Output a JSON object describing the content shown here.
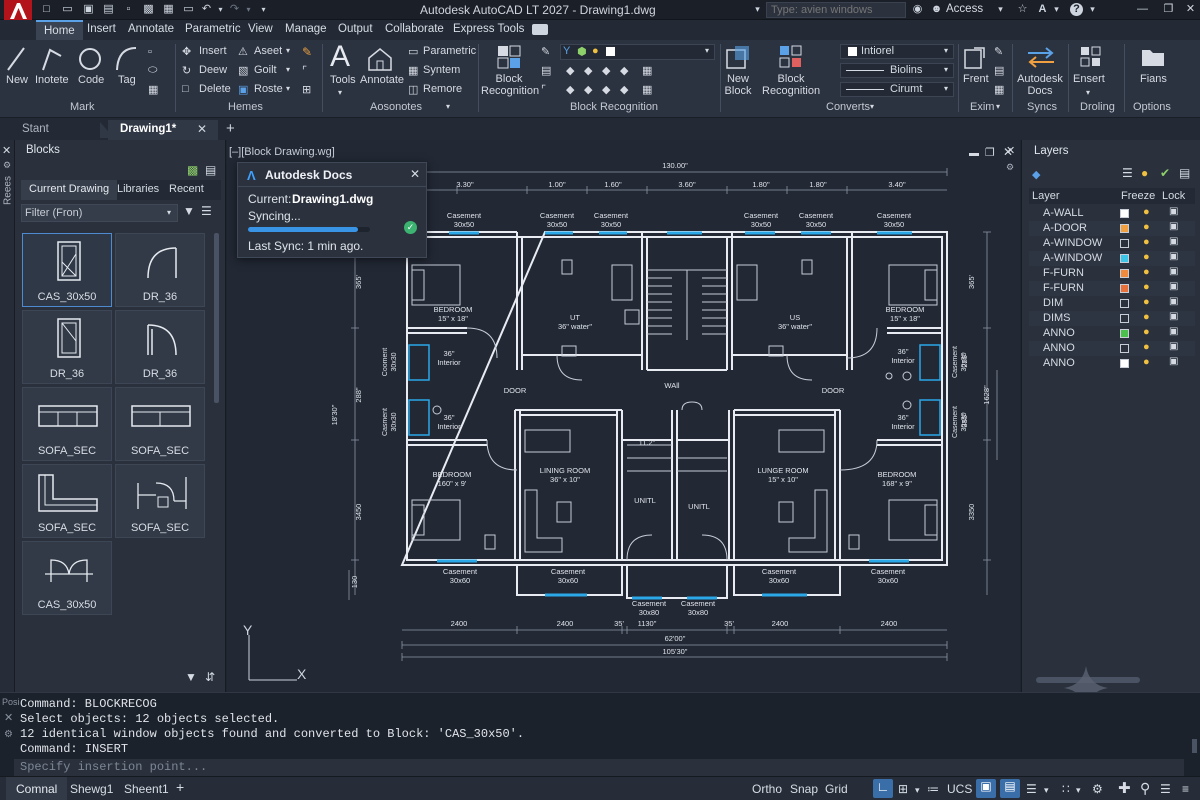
{
  "app": {
    "title": "Autodesk AutoCAD LT 2027 - Drawing1.dwg",
    "search_placeholder": "Type: avien windows",
    "access": "Access"
  },
  "menus": [
    "Home",
    "Insert",
    "Annotate",
    "Parametric",
    "View",
    "Manage",
    "Output",
    "Collaborate",
    "Express Tools"
  ],
  "ribbon": {
    "mark": {
      "new": "New",
      "inotete": "Inotete",
      "code": "Code",
      "tag": "Tag",
      "label": "Mark"
    },
    "hemes": {
      "insert": "Insert",
      "deew": "Deew",
      "delete": "Delete",
      "aseet": "Aseet",
      "goilt": "Goilt",
      "roste": "Roste",
      "label": "Hemes"
    },
    "aosonotes": {
      "tools": "Tools",
      "annotate": "Annotate",
      "parametric": "Parametric",
      "syntem": "Syntem",
      "remore": "Remore",
      "label": "Aosonotes"
    },
    "block_recognition": {
      "btn": "Block\nRecognition",
      "label": "Block Recognition"
    },
    "converts": {
      "new_block": "New\nBlock",
      "block_recognition": "Block\nRecognition",
      "dd1": "Intiorel",
      "dd2": "Biolins",
      "dd3": "Cirumt",
      "label": "Converts"
    },
    "exim": {
      "frent": "Frent",
      "label": "Exim"
    },
    "syncs": {
      "docs": "Autodesk\nDocs",
      "label": "Syncs"
    },
    "droling": {
      "ensert": "Ensert",
      "label": "Droling"
    },
    "options": {
      "fians": "Fians",
      "label": "Options"
    }
  },
  "doc_tabs": {
    "start": "Stant",
    "drawing": "Drawing1*"
  },
  "blocks_panel": {
    "title": "Blocks",
    "side_label": "Reees",
    "tabs": [
      "Current Drawing",
      "Libraries",
      "Recent"
    ],
    "filter": "Filter (Fron)",
    "items": [
      {
        "name": "CAS_30x50"
      },
      {
        "name": "DR_36"
      },
      {
        "name": "DR_36"
      },
      {
        "name": "DR_36"
      },
      {
        "name": "SOFA_SEC"
      },
      {
        "name": "SOFA_SEC"
      },
      {
        "name": "SOFA_SEC"
      },
      {
        "name": "SOFA_SEC"
      },
      {
        "name": "CAS_30x50"
      }
    ]
  },
  "viewport": {
    "label": "[–][Block Drawing.wg]"
  },
  "docs_popup": {
    "title": "Autodesk Docs",
    "current_label": "Current:",
    "current_file": "Drawing1.dwg",
    "status": "Syncing...",
    "progress": 0.9,
    "last_sync": "Last Sync: 1 min ago."
  },
  "drawing": {
    "dims_top": [
      "130.00\"",
      "3.30\"",
      "1.00\"",
      "1.60\"",
      "3.60\"",
      "1.80\"",
      "1.80\"",
      "3.40\""
    ],
    "dims_bottom": [
      "2400",
      "2400",
      "35'",
      "1130\"",
      "35'",
      "2400",
      "2400"
    ],
    "dims_total": [
      "62'00\"",
      "105'30\""
    ],
    "dims_left": [
      "365'",
      "288\"",
      "18'30\"",
      "3450",
      "130"
    ],
    "dims_right": [
      "365'",
      "229\"",
      "1628\"",
      "335\"",
      "3350"
    ],
    "rooms": [
      {
        "t": "BEDROOM",
        "s": "15\" x 18\""
      },
      {
        "t": "UT",
        "s": "36\" water\""
      },
      {
        "t": "US",
        "s": "36\" water\""
      },
      {
        "t": "BEDROOM",
        "s": "15\" x 18\""
      },
      {
        "t": "36\"",
        "s": "Interior"
      },
      {
        "t": "36\"",
        "s": "Interior"
      },
      {
        "t": "36\"",
        "s": "Interior"
      },
      {
        "t": "36\"",
        "s": "Interior"
      },
      {
        "t": "DOOR",
        "s": ""
      },
      {
        "t": "WAll",
        "s": ""
      },
      {
        "t": "DOOR",
        "s": ""
      },
      {
        "t": "11.2\"",
        "s": ""
      },
      {
        "t": "LINING ROOM",
        "s": "36\" x 10\""
      },
      {
        "t": "LUNGE ROOM",
        "s": "15\" x 10\""
      },
      {
        "t": "BEDROOM",
        "s": "160\" x 9'"
      },
      {
        "t": "BEDROOM",
        "s": "168\" x 9\""
      },
      {
        "t": "UNITL",
        "s": ""
      },
      {
        "t": "UNITL",
        "s": ""
      }
    ],
    "casements": [
      {
        "t": "Casement",
        "s": "30x50"
      },
      {
        "t": "Casement",
        "s": "30x50"
      },
      {
        "t": "Casement",
        "s": "30x50"
      },
      {
        "t": "Casement",
        "s": "30x50"
      },
      {
        "t": "Casement",
        "s": "30x50"
      },
      {
        "t": "Casement",
        "s": "30x50"
      },
      {
        "t": "Casement",
        "s": "30x60"
      },
      {
        "t": "Casement",
        "s": "30x60"
      },
      {
        "t": "Casement",
        "s": "30x80"
      },
      {
        "t": "Casement",
        "s": "30x80"
      },
      {
        "t": "Casement",
        "s": "30x60"
      },
      {
        "t": "Casement",
        "s": "30x60"
      }
    ],
    "side_casements": [
      {
        "t": "Cooment",
        "s": "30x30"
      },
      {
        "t": "Casment",
        "s": "30x30"
      },
      {
        "t": "Casement",
        "s": "30x30"
      },
      {
        "t": "Casement",
        "s": "30x30"
      }
    ],
    "axis_y": "Y",
    "axis_x": "X"
  },
  "layers_panel": {
    "title": "Layers",
    "headers": [
      "Layer",
      "Freeze",
      "Lock"
    ],
    "rows": [
      {
        "name": "A-WALL",
        "color": "#ffffff"
      },
      {
        "name": "A-DOOR",
        "color": "#f0a040"
      },
      {
        "name": "A-WINDOW",
        "color": "#2b323e"
      },
      {
        "name": "A-WINDOW",
        "color": "#3ec6e8"
      },
      {
        "name": "F-FURN",
        "color": "#f08a3c"
      },
      {
        "name": "F-FURN",
        "color": "#e8703a"
      },
      {
        "name": "DIM",
        "color": "#2b323e"
      },
      {
        "name": "DIMS",
        "color": "#2b323e"
      },
      {
        "name": "ANNO",
        "color": "#4cc04c"
      },
      {
        "name": "ANNO",
        "color": "#2b323e"
      },
      {
        "name": "ANNO",
        "color": "#ffffff"
      }
    ]
  },
  "command": {
    "side_label": "Posi",
    "lines": [
      "Command: BLOCKRECOG",
      "Select objects: 12 objects selected.",
      "12 identical window objects found and converted to Block: 'CAS_30x50'.",
      "Command: INSERT"
    ],
    "prompt": "Specify insertion point..."
  },
  "status": {
    "tabs": [
      "Comnal",
      "Shewg1",
      "Sheent1"
    ],
    "toggles": [
      "Ortho",
      "Snap",
      "Grid"
    ],
    "ucs": "UCS"
  }
}
